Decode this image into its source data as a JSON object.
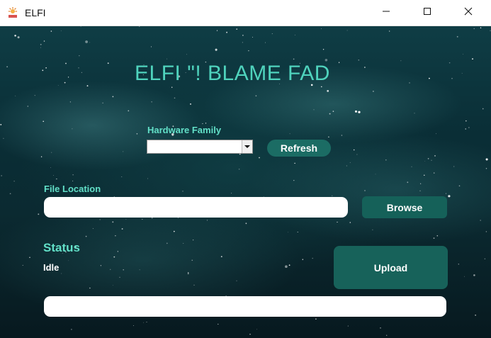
{
  "window": {
    "title": "ELFI",
    "icon": "elfi-app-icon"
  },
  "window_controls": {
    "minimize": "minimize-icon",
    "maximize": "maximize-icon",
    "close": "close-icon"
  },
  "main": {
    "heading": "ELFI \"! BLAME FAD",
    "hardware_family": {
      "label": "Hardware Family",
      "selected_value": "",
      "options": []
    },
    "refresh_label": "Refresh",
    "file_location": {
      "label": "File Location",
      "value": "",
      "placeholder": ""
    },
    "browse_label": "Browse",
    "status": {
      "label": "Status",
      "text": "Idle"
    },
    "upload_label": "Upload",
    "progress": {
      "value": 0
    }
  },
  "colors": {
    "accent": "#4fd3bd",
    "button": "#156159",
    "background_dark": "#0a2e36"
  }
}
